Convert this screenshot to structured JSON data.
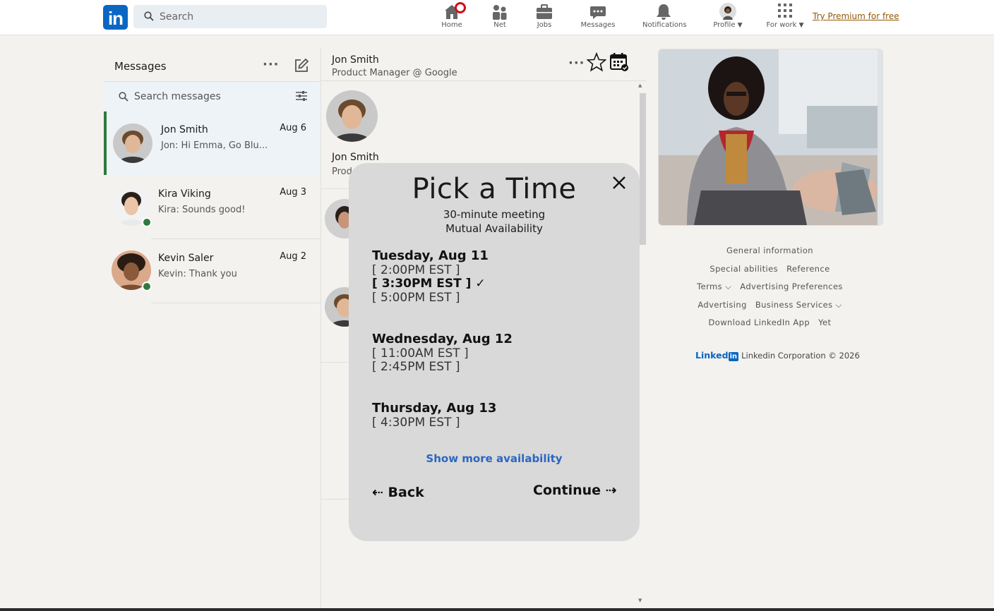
{
  "nav": {
    "logo_text": "in",
    "search_placeholder": "Search",
    "items": [
      {
        "label": "Home",
        "icon": "home-icon"
      },
      {
        "label": "Net",
        "icon": "network-icon"
      },
      {
        "label": "Jobs",
        "icon": "briefcase-icon"
      },
      {
        "label": "Messages",
        "icon": "messages-icon"
      },
      {
        "label": "Notifications",
        "icon": "bell-icon"
      },
      {
        "label": "Profile",
        "icon": "profile-avatar"
      },
      {
        "label": "For work",
        "icon": "grid-icon"
      }
    ],
    "premium_link": "Try Premium for free",
    "accent_color": "#0a66c2",
    "badge_color": "#cc1016"
  },
  "messages": {
    "title": "Messages",
    "search_placeholder": "Search messages",
    "conversations": [
      {
        "name": "Jon Smith",
        "date": "Aug 6",
        "preview": "Jon:  Hi Emma, Go Blu...",
        "active": true,
        "online": false
      },
      {
        "name": "Kira Viking",
        "date": "Aug 3",
        "preview": "Kira:  Sounds good!",
        "active": false,
        "online": true
      },
      {
        "name": "Kevin Saler",
        "date": "Aug 2",
        "preview": "Kevin:  Thank you",
        "active": false,
        "online": true
      }
    ],
    "active_color": "#2e7a3f"
  },
  "chat": {
    "name": "Jon Smith",
    "subtitle": "Product Manager @ Google",
    "body_name": "Jon Smith",
    "body_sub": "Prod"
  },
  "modal": {
    "title": "Pick a Time",
    "subtitle_1": "30-minute meeting",
    "subtitle_2": "Mutual Availability",
    "days": [
      {
        "day": "Tuesday, Aug 11",
        "slots": [
          "[ 2:00PM EST ]",
          "[ 3:30PM EST ] ✓",
          "[ 5:00PM EST ]"
        ]
      },
      {
        "day": "Wednesday, Aug 12",
        "slots": [
          "[ 11:00AM EST ]",
          "[ 2:45PM EST ]"
        ]
      },
      {
        "day": "Thursday, Aug 13",
        "slots": [
          "[ 4:30PM EST ]"
        ]
      }
    ],
    "selected_slot": "[ 3:30PM EST ] ✓",
    "show_more": "Show more availability",
    "back": "⇠ Back",
    "continue": "Continue ⇢",
    "link_color": "#2a66c0"
  },
  "footer": {
    "links": [
      [
        "General information"
      ],
      [
        "Special abilities",
        "Reference"
      ],
      [
        "Terms ⌵",
        "Advertising Preferences"
      ],
      [
        "Advertising",
        "Business Services ⌵"
      ],
      [
        "Download LinkedIn App",
        "Yet"
      ]
    ],
    "brand_text": "Linked",
    "brand_box": "in",
    "copyright": "Linkedin Corporation © 2026"
  }
}
